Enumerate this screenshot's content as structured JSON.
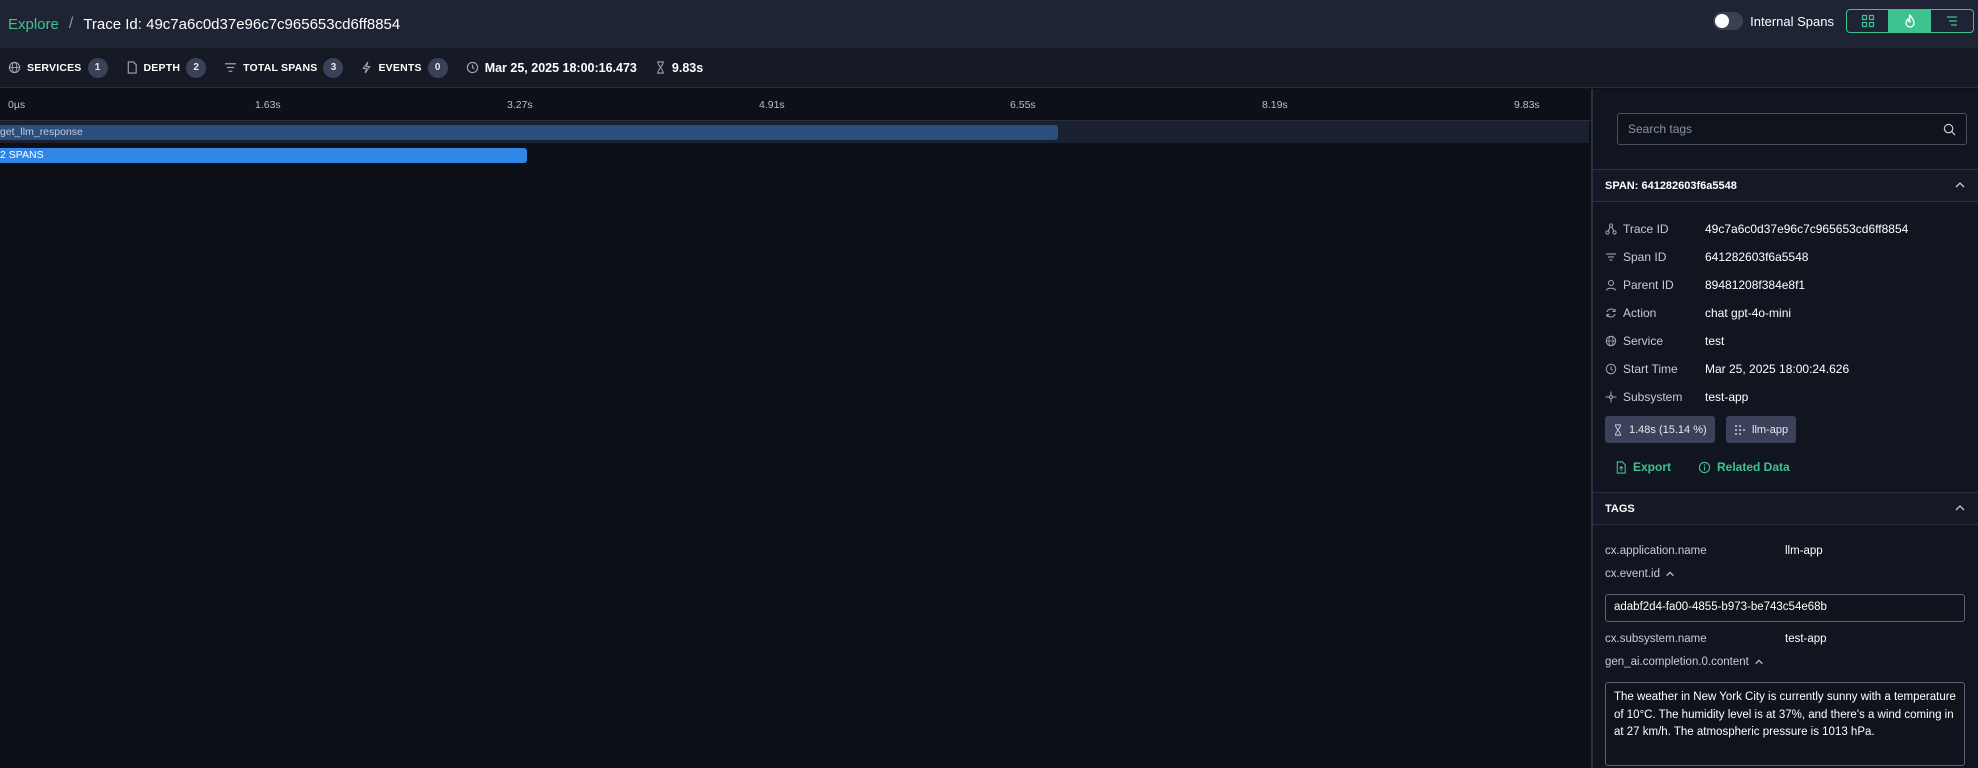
{
  "breadcrumb": {
    "explore": "Explore",
    "separator": "/",
    "title": "Trace Id: 49c7a6c0d37e96c7c965653cd6ff8854"
  },
  "header": {
    "internal_spans_label": "Internal Spans",
    "internal_spans_on": false,
    "views": [
      "dependencies-icon",
      "flame-icon",
      "list-icon"
    ],
    "active_view": 1
  },
  "stats": {
    "services_label": "SERVICES",
    "services_count": "1",
    "depth_label": "DEPTH",
    "depth_count": "2",
    "total_spans_label": "TOTAL SPANS",
    "total_spans_count": "3",
    "events_label": "EVENTS",
    "events_count": "0",
    "start": "Mar 25, 2025 18:00:16.473",
    "duration": "9.83s"
  },
  "timeline": {
    "ticks": [
      "0µs",
      "1.63s",
      "3.27s",
      "4.91s",
      "6.55s",
      "8.19s",
      "9.83s"
    ],
    "spans": [
      {
        "label": "get_llm_response",
        "fraction": 0.665
      },
      {
        "label": "2 SPANS",
        "fraction": 0.331
      }
    ]
  },
  "panel": {
    "search_placeholder": "Search tags",
    "span_header": "SPAN: 641282603f6a5548",
    "fields": [
      {
        "icon": "trace-icon",
        "label": "Trace ID",
        "value": "49c7a6c0d37e96c7c965653cd6ff8854"
      },
      {
        "icon": "span-icon",
        "label": "Span ID",
        "value": "641282603f6a5548"
      },
      {
        "icon": "person-icon",
        "label": "Parent ID",
        "value": "89481208f384e8f1"
      },
      {
        "icon": "refresh-icon",
        "label": "Action",
        "value": "chat gpt-4o-mini"
      },
      {
        "icon": "globe-icon",
        "label": "Service",
        "value": "test"
      },
      {
        "icon": "clock-icon",
        "label": "Start Time",
        "value": "Mar 25, 2025 18:00:24.626"
      },
      {
        "icon": "subsystem-icon",
        "label": "Subsystem",
        "value": "test-app"
      }
    ],
    "chips": {
      "duration": "1.48s (15.14 %)",
      "app": "llm-app"
    },
    "export_label": "Export",
    "related_label": "Related Data",
    "tags_header": "TAGS",
    "tags": {
      "app_name_key": "cx.application.name",
      "app_name_value": "llm-app",
      "event_id_key": "cx.event.id",
      "event_id_value": "adabf2d4-fa00-4855-b973-be743c54e68b",
      "subsystem_key": "cx.subsystem.name",
      "subsystem_value": "test-app",
      "completion_key": "gen_ai.completion.0.content",
      "completion_value": "The weather in New York City is currently sunny with a temperature of 10°C. The humidity level is at 37%, and there's a wind coming in at 27 km/h. The atmospheric pressure is 1013 hPa."
    }
  },
  "colors": {
    "accent": "#3ec28f",
    "span_dark": "#2a4f7f",
    "span_bright": "#2f86e6"
  }
}
